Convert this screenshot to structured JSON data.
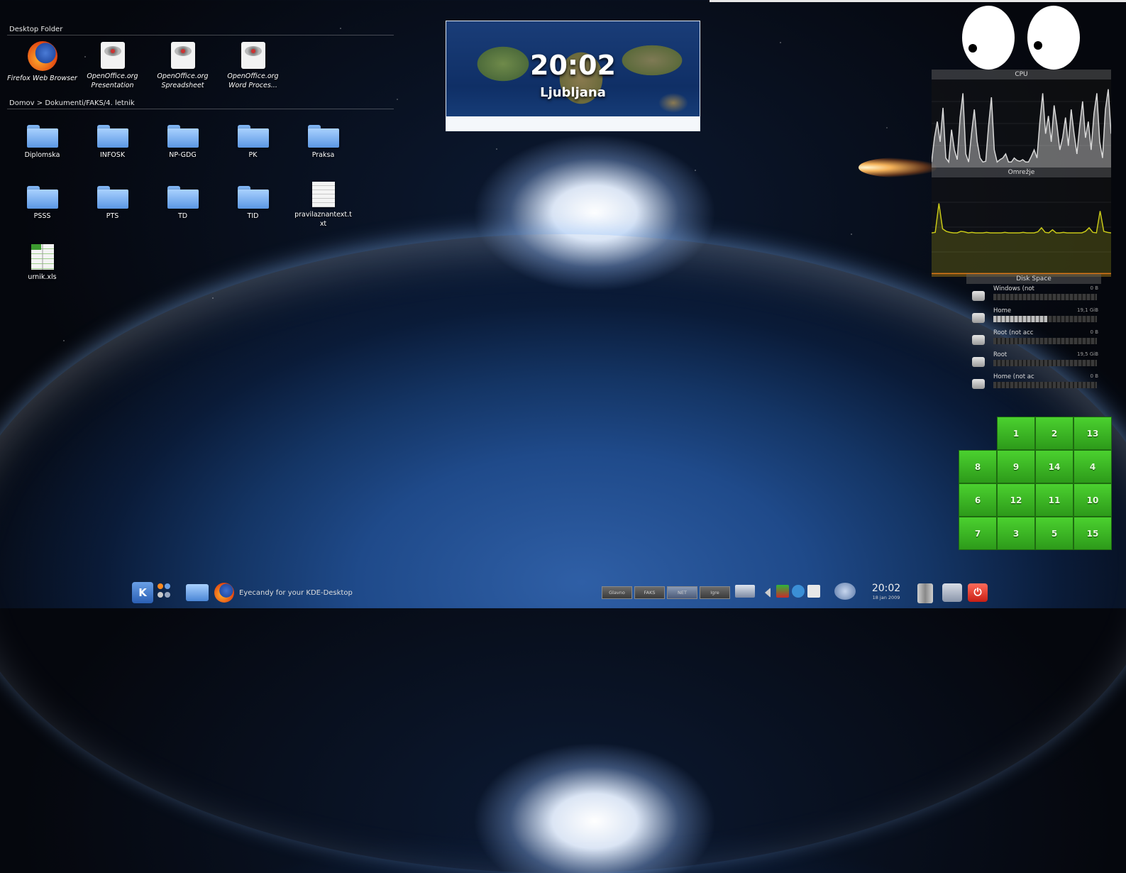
{
  "desktop_folder": {
    "title": "Desktop Folder",
    "items": [
      {
        "label": "Firefox Web Browser",
        "icon": "firefox-icon"
      },
      {
        "label": "OpenOffice.org Presentation",
        "icon": "presentation-icon"
      },
      {
        "label": "OpenOffice.org Spreadsheet",
        "icon": "spreadsheet-icon"
      },
      {
        "label": "OpenOffice.org Word Proces...",
        "icon": "word-processor-icon"
      }
    ]
  },
  "folder_view": {
    "path": "Domov > Dokumenti/FAKS/4. letnik",
    "items": [
      {
        "label": "Diplomska",
        "type": "folder"
      },
      {
        "label": "INFOSK",
        "type": "folder"
      },
      {
        "label": "NP-GDG",
        "type": "folder"
      },
      {
        "label": "PK",
        "type": "folder"
      },
      {
        "label": "Praksa",
        "type": "folder"
      },
      {
        "label": "PSSS",
        "type": "folder"
      },
      {
        "label": "PTS",
        "type": "folder"
      },
      {
        "label": "TD",
        "type": "folder"
      },
      {
        "label": "TID",
        "type": "folder"
      },
      {
        "label": "pravilaznantext.txt",
        "type": "text"
      },
      {
        "label": "urnik.xls",
        "type": "spreadsheet"
      }
    ]
  },
  "world_clock": {
    "time": "20:02",
    "city": "Ljubljana"
  },
  "system_monitor": {
    "cpu": {
      "title": "CPU",
      "color": "#d8d8d8",
      "values": [
        0.05,
        0.35,
        0.55,
        0.3,
        0.72,
        0.1,
        0.05,
        0.45,
        0.2,
        0.08,
        0.6,
        0.9,
        0.15,
        0.05,
        0.4,
        0.7,
        0.3,
        0.1,
        0.05,
        0.06,
        0.5,
        0.85,
        0.2,
        0.05,
        0.08,
        0.1,
        0.15,
        0.05,
        0.05,
        0.1,
        0.07,
        0.06,
        0.08,
        0.05,
        0.05,
        0.12,
        0.2,
        0.1,
        0.55,
        0.9,
        0.4,
        0.62,
        0.3,
        0.75,
        0.5,
        0.2,
        0.35,
        0.6,
        0.25,
        0.7,
        0.4,
        0.15,
        0.5,
        0.8,
        0.35,
        0.55,
        0.2,
        0.65,
        0.9,
        0.3,
        0.1,
        0.7,
        0.95,
        0.4
      ]
    },
    "network": {
      "title": "Omrežje",
      "color": "#c8c818",
      "values": [
        0.02,
        0.03,
        0.6,
        0.1,
        0.05,
        0.03,
        0.02,
        0.02,
        0.05,
        0.04,
        0.02,
        0.03,
        0.02,
        0.02,
        0.02,
        0.03,
        0.02,
        0.02,
        0.02,
        0.02,
        0.03,
        0.02,
        0.02,
        0.02,
        0.02,
        0.03,
        0.02,
        0.02,
        0.02,
        0.04,
        0.12,
        0.03,
        0.02,
        0.08,
        0.02,
        0.02,
        0.03,
        0.02,
        0.02,
        0.02,
        0.02,
        0.02,
        0.05,
        0.12,
        0.03,
        0.02,
        0.45,
        0.05,
        0.03,
        0.02
      ],
      "second_color": "#e07818",
      "second_values": [
        0.02,
        0.02,
        0.02,
        0.02,
        0.02,
        0.02,
        0.02,
        0.02,
        0.02,
        0.02,
        0.02,
        0.02,
        0.02,
        0.02,
        0.02,
        0.02,
        0.02,
        0.02,
        0.02,
        0.02,
        0.02,
        0.02,
        0.02,
        0.02,
        0.02,
        0.02,
        0.02,
        0.02,
        0.02,
        0.02
      ]
    }
  },
  "disk_space": {
    "title": "Disk Space",
    "disks": [
      {
        "label": "Windows (not",
        "size": "0 B",
        "fill": 0.0
      },
      {
        "label": "Home",
        "size": "19,1 GiB",
        "fill": 0.52
      },
      {
        "label": "Root (not acc",
        "size": "0 B",
        "fill": 0.0
      },
      {
        "label": "Root",
        "size": "19,5 GiB",
        "fill": 0.0
      },
      {
        "label": "Home (not ac",
        "size": "0 B",
        "fill": 0.0
      }
    ]
  },
  "puzzle": {
    "tiles": [
      "",
      "1",
      "2",
      "13",
      "8",
      "9",
      "14",
      "4",
      "6",
      "12",
      "11",
      "10",
      "7",
      "3",
      "5",
      "15"
    ]
  },
  "taskbar": {
    "kmenu_label": "K",
    "task_label": "Eyecandy for your KDE-Desktop",
    "pager": [
      "Glavno",
      "FAKS",
      "NET",
      "Igre"
    ],
    "clock_time": "20:02",
    "clock_date": "18 jan 2009",
    "power_symbol": "⏻"
  }
}
